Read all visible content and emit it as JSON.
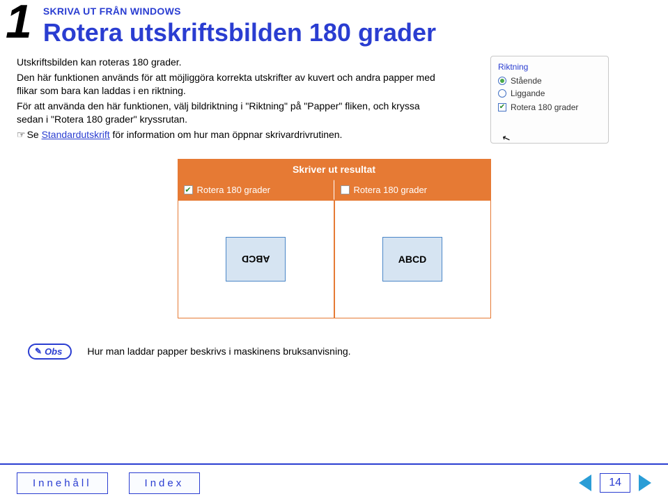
{
  "header": {
    "chapter_number": "1",
    "section_label": "SKRIVA UT FRÅN WINDOWS",
    "title": "Rotera utskriftsbilden 180 grader"
  },
  "body": {
    "p1": "Utskriftsbilden kan roteras 180 grader.",
    "p2": "Den här funktionen används för att möjliggöra korrekta utskrifter av kuvert och andra papper med flikar som bara kan laddas i en riktning.",
    "p3": "För att använda den här funktionen, välj bildriktning i \"Riktning\" på \"Papper\" fliken, och kryssa sedan i \"Rotera 180 grader\" kryssrutan.",
    "link_prefix": "Se ",
    "link_text": "Standardutskrift",
    "link_suffix": " för information om hur man öppnar skrivardrivrutinen."
  },
  "riktning_panel": {
    "title": "Riktning",
    "opt_staende": "Stående",
    "opt_liggande": "Liggande",
    "chk_rotera": "Rotera 180 grader"
  },
  "table": {
    "title": "Skriver ut resultat",
    "col1_label": "Rotera 180 grader",
    "col2_label": "Rotera 180 grader",
    "sample_text": "ABCD"
  },
  "obs": {
    "badge": "Obs",
    "text": "Hur man laddar papper beskrivs i maskinens bruksanvisning."
  },
  "footer": {
    "btn_contents": "Innehåll",
    "btn_index": "Index",
    "page_number": "14"
  }
}
